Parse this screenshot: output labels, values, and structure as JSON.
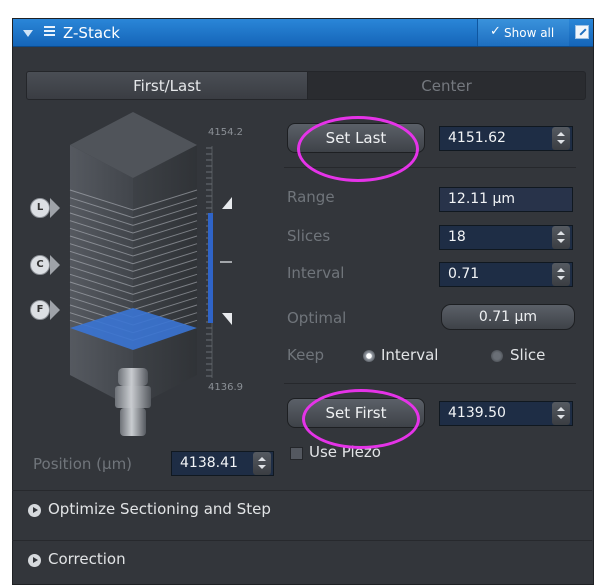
{
  "titlebar": {
    "title": "Z-Stack",
    "show_all_check": "✓",
    "show_all_label": "Show all"
  },
  "tabs": [
    {
      "label": "First/Last",
      "active": true
    },
    {
      "label": "Center",
      "active": false
    }
  ],
  "scale": {
    "top_label": "4154.2",
    "bottom_label": "4136.9"
  },
  "markers": {
    "last": "L",
    "center": "C",
    "first": "F"
  },
  "set_last": {
    "label": "Set Last",
    "value": "4151.62"
  },
  "range": {
    "label": "Range",
    "value": "12.11 µm"
  },
  "slices": {
    "label": "Slices",
    "value": "18"
  },
  "interval": {
    "label": "Interval",
    "value": "0.71"
  },
  "optimal": {
    "label": "Optimal",
    "button": "0.71 µm"
  },
  "keep": {
    "label": "Keep",
    "options": [
      "Interval",
      "Slice"
    ],
    "selected": "Interval"
  },
  "set_first": {
    "label": "Set First",
    "value": "4139.50"
  },
  "use_piezo": {
    "label": "Use Piezo",
    "checked": false
  },
  "position": {
    "label": "Position (µm)",
    "value": "4138.41"
  },
  "sections": [
    {
      "label": "Optimize Sectioning and Step"
    },
    {
      "label": "Correction"
    }
  ],
  "colors": {
    "accent": "#1e6fc0",
    "highlight": "#e533e8",
    "panel": "#33363b"
  }
}
